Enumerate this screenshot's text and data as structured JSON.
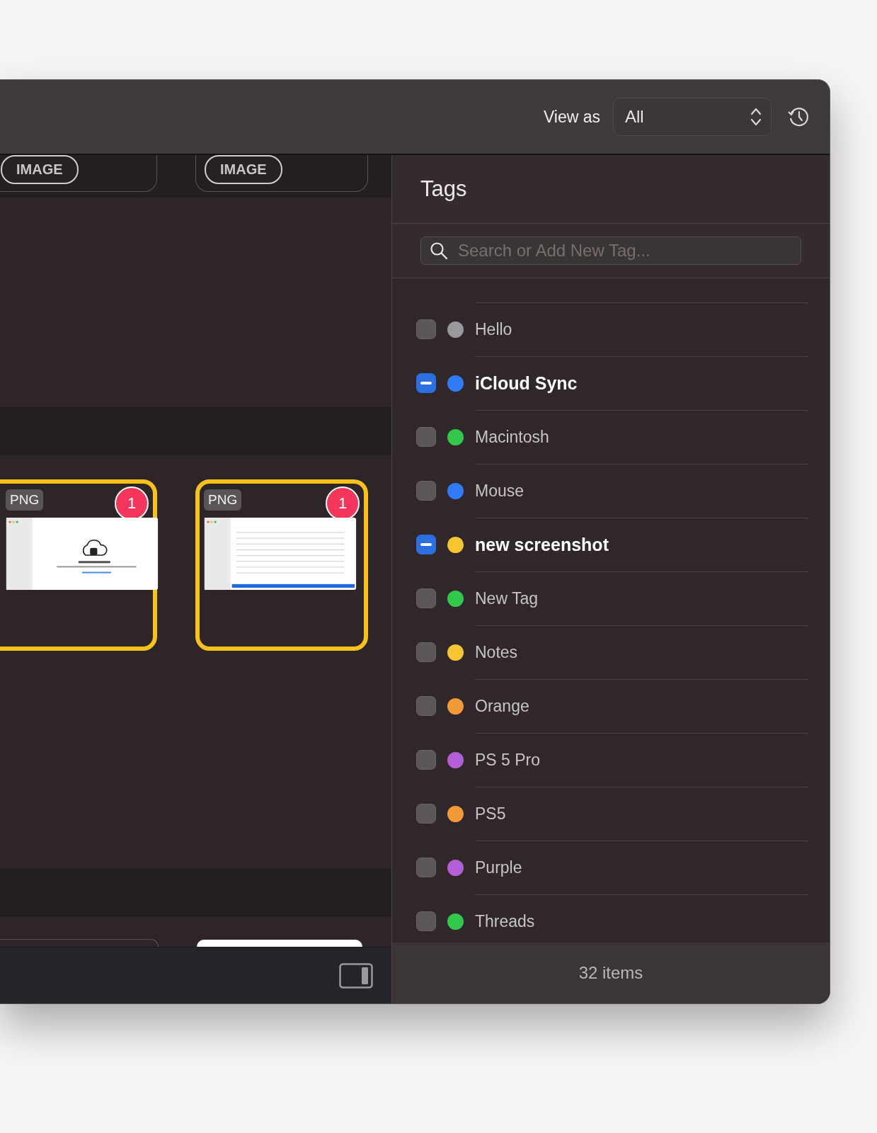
{
  "toolbar": {
    "view_as_label": "View as",
    "view_as_value": "All"
  },
  "cards_top": [
    {
      "badge": "IMAGE"
    },
    {
      "badge": "IMAGE"
    }
  ],
  "cards": [
    {
      "type_badge": "PNG",
      "count": "1",
      "selected": true,
      "kind": "cloud"
    },
    {
      "type_badge": "PNG",
      "count": "1",
      "selected": true,
      "kind": "list"
    }
  ],
  "tags_panel": {
    "title": "Tags",
    "search": {
      "placeholder": "Search or Add New Tag..."
    },
    "items": [
      {
        "name": "Hello",
        "color": "#98989d",
        "checked": false
      },
      {
        "name": "iCloud Sync",
        "color": "#2f7cf6",
        "checked": true
      },
      {
        "name": "Macintosh",
        "color": "#34c84a",
        "checked": false
      },
      {
        "name": "Mouse",
        "color": "#2f7cf6",
        "checked": false
      },
      {
        "name": "new screenshot",
        "color": "#f5c631",
        "checked": true
      },
      {
        "name": "New Tag",
        "color": "#34c84a",
        "checked": false
      },
      {
        "name": "Notes",
        "color": "#f5c631",
        "checked": false
      },
      {
        "name": "Orange",
        "color": "#f29a38",
        "checked": false
      },
      {
        "name": "PS 5 Pro",
        "color": "#b35fd6",
        "checked": false
      },
      {
        "name": "PS5",
        "color": "#f29a38",
        "checked": false
      },
      {
        "name": "Purple",
        "color": "#b35fd6",
        "checked": false
      },
      {
        "name": "Threads",
        "color": "#34c84a",
        "checked": false
      }
    ],
    "footer": "32 items"
  }
}
